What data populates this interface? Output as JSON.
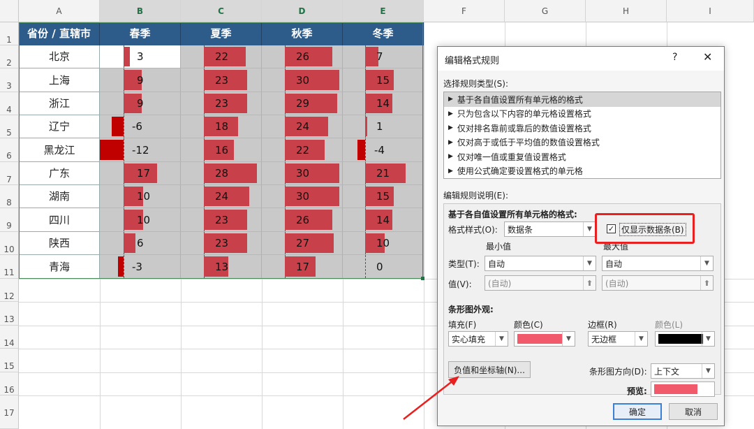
{
  "sheet": {
    "columns": [
      "A",
      "B",
      "C",
      "D",
      "E",
      "F",
      "G",
      "H",
      "I"
    ],
    "rows": [
      "1",
      "2",
      "3",
      "4",
      "5",
      "6",
      "7",
      "8",
      "9",
      "10",
      "11",
      "12",
      "13",
      "14",
      "15",
      "16",
      "17"
    ],
    "header": [
      "省份 / 直辖市",
      "春季",
      "夏季",
      "秋季",
      "冬季"
    ],
    "provinces": [
      "北京",
      "上海",
      "浙江",
      "辽宁",
      "黑龙江",
      "广东",
      "湖南",
      "四川",
      "陕西",
      "青海"
    ],
    "spring": [
      "3",
      "9",
      "9",
      "-6",
      "-12",
      "17",
      "10",
      "10",
      "6",
      "-3"
    ],
    "summer": [
      "22",
      "23",
      "23",
      "18",
      "16",
      "28",
      "24",
      "23",
      "23",
      "13"
    ],
    "autumn": [
      "26",
      "30",
      "29",
      "24",
      "22",
      "30",
      "30",
      "26",
      "27",
      "17"
    ],
    "winter": [
      "7",
      "15",
      "14",
      "1",
      "-4",
      "21",
      "15",
      "14",
      "10",
      "0"
    ],
    "colors": {
      "header_bg": "#2e5c8a",
      "bar": "#c8404a",
      "neg_bar": "#c00000",
      "cell_bg": "#c9c9c9"
    }
  },
  "dialog": {
    "title": "编辑格式规则",
    "help": "?",
    "close": "✕",
    "select_rule_type": "选择规则类型(S):",
    "rule_types": [
      "基于各自值设置所有单元格的格式",
      "只为包含以下内容的单元格设置格式",
      "仅对排名靠前或靠后的数值设置格式",
      "仅对高于或低于平均值的数值设置格式",
      "仅对唯一值或重复值设置格式",
      "使用公式确定要设置格式的单元格"
    ],
    "edit_desc": "编辑规则说明(E):",
    "format_all": "基于各自值设置所有单元格的格式:",
    "format_style_label": "格式样式(O):",
    "format_style_value": "数据条",
    "show_bar_only": "仅显示数据条(B)",
    "min_label": "最小值",
    "max_label": "最大值",
    "type_label": "类型(T):",
    "type_min": "自动",
    "type_max": "自动",
    "value_label": "值(V):",
    "value_min": "(自动)",
    "value_max": "(自动)",
    "bar_appearance": "条形图外观:",
    "fill_label": "填充(F)",
    "fill_value": "实心填充",
    "color_label": "颜色(C)",
    "border_label": "边框(R)",
    "border_value": "无边框",
    "border_color_label": "颜色(L)",
    "neg_axis_button": "负值和坐标轴(N)...",
    "direction_label": "条形图方向(D):",
    "direction_value": "上下文",
    "preview_label": "预览:",
    "ok": "确定",
    "cancel": "取消",
    "colors": {
      "fill": "#f05a6a",
      "border": "#000000",
      "highlight": "#e8201f"
    }
  }
}
